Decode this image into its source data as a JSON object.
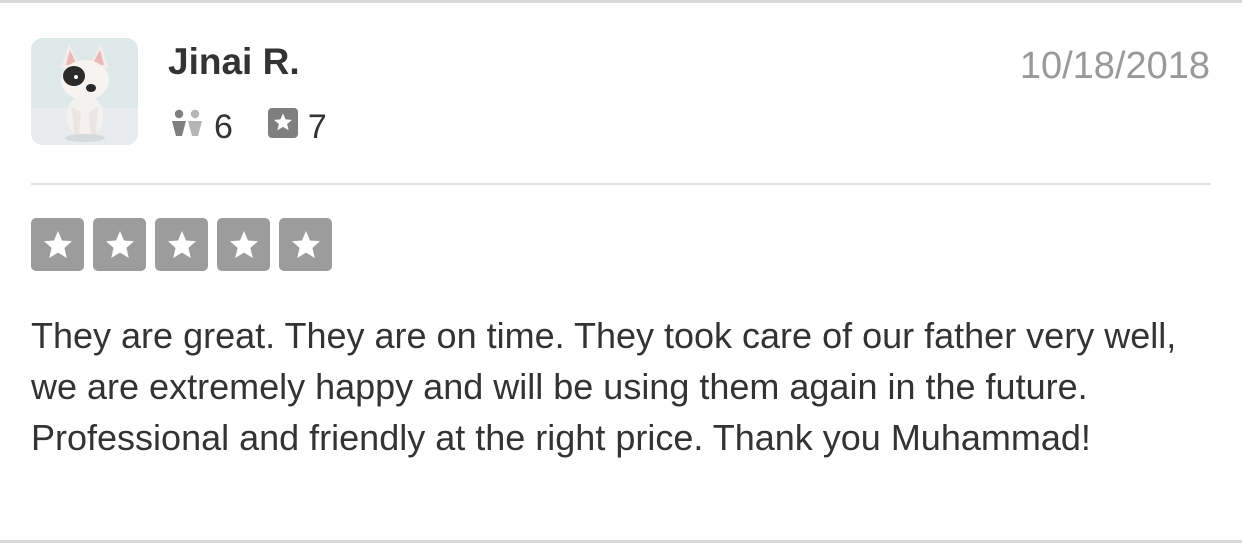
{
  "review": {
    "user": {
      "name": "Jinai R.",
      "avatar_icon": "dog-avatar-icon",
      "friends_count": "6",
      "friends_icon": "friends-icon",
      "reviews_count": "7",
      "reviews_icon": "review-star-icon"
    },
    "date": "10/18/2018",
    "rating": {
      "value": 5,
      "max": 5,
      "star_color": "#9c9c9c"
    },
    "text": "They are great. They are on time. They took care of our father very well, we are extremely happy and will be using them again in the future. Professional and friendly at the right price. Thank you Muhammad!"
  }
}
